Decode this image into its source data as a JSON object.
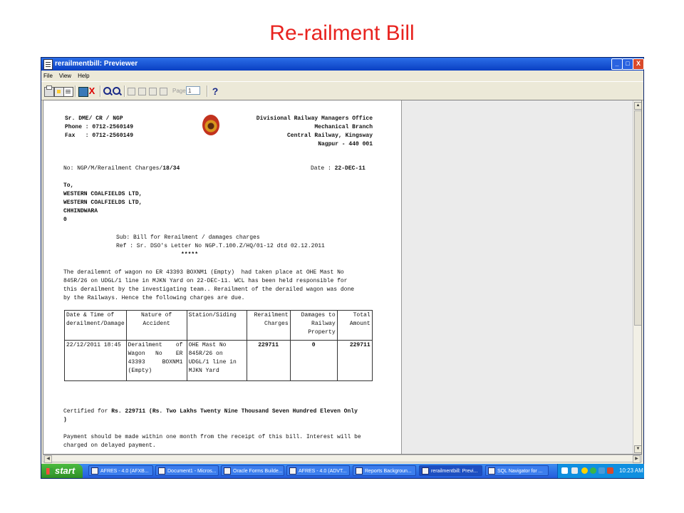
{
  "slide": {
    "title": "Re-railment Bill"
  },
  "window": {
    "title": "rerailmentbill: Previewer",
    "btn_min": "_",
    "btn_max": "□",
    "btn_close": "X"
  },
  "menu": {
    "file": "File",
    "view": "View",
    "help": "Help"
  },
  "toolbar": {
    "page_label": "Page",
    "page_value": "1",
    "close_glyph": "X",
    "help_glyph": "?"
  },
  "document": {
    "sender": {
      "line1": "Sr. DME/ CR / NGP",
      "phone": "Phone : 0712-2560149",
      "fax": "Fax   : 0712-2560149"
    },
    "office": {
      "line1": "Divisional Railway Managers Office",
      "line2": "Mechanical Branch",
      "line3": "Central Railway, Kingsway",
      "line4": "Nagpur - 440 001"
    },
    "ref_no_prefix": "No: NGP/M/Rerailment Charges/",
    "ref_no_bold": "18/34",
    "date_label": "Date : ",
    "date_value": "22-DEC-11",
    "to": {
      "label": "To,",
      "line1": "WESTERN COALFIELDS LTD,",
      "line2": "WESTERN COALFIELDS LTD,",
      "line3": "CHHINDWARA",
      "line4": "0"
    },
    "subject": "Sub: Bill for Rerailment / damages charges",
    "reference": "Ref : Sr. DSO's Letter No NGP.T.100.Z/HQ/01-12 dtd 02.12.2011",
    "stars": "*****",
    "para1": "The derailemnt of wagon no ER 43393 BOXNM1 (Empty)  had taken place at OHE Mast No",
    "para2": "845R/26 on UDGL/1 line in MJKN Yard on 22-DEC-11. WCL has been held responsible for",
    "para3": "this derailment by the investigating team.. Rerailment of the derailed wagon was done",
    "para4": "by the Railways. Hence the following charges are due.",
    "table": {
      "headers": {
        "date1": "Date & Time of",
        "date2": "derailment/Damage",
        "nature1": "Nature of",
        "nature2": "Accident",
        "station": "Station/Siding",
        "rerail1": "Rerailment",
        "rerail2": "Charges",
        "damage1": "Damages to",
        "damage2": "Railway",
        "damage3": "Property",
        "total1": "Total",
        "total2": "Amount"
      },
      "row": {
        "datetime": "22/12/2011 18:45",
        "nature1": "Derailment    of",
        "nature2": "Wagon   No    ER",
        "nature3": "43393     BOXNM1",
        "nature4": "(Empty)",
        "station1": "OHE Mast No",
        "station2": "845R/26 on",
        "station3": "UDGL/1 line in",
        "station4": "MJKN Yard",
        "rerailment": "229711",
        "damages": "0",
        "total": "229711"
      }
    },
    "certified_prefix": "Certified for ",
    "certified_bold": "Rs. 229711 (Rs. Two Lakhs Twenty Nine Thousand Seven Hundred Eleven Only",
    "certified_close": ")",
    "payment1": "Payment should be made within one month from the receipt of this bill. Interest will be",
    "payment2": "charged on delayed payment."
  },
  "taskbar": {
    "start": "start",
    "items": [
      "AFRES - 4.0 (AFXB...",
      "Document1 - Micros...",
      "Oracle Forms Builde...",
      "AFRES - 4.0 (ADVT...",
      "Reports Backgroun...",
      "rerailmentbill: Previ...",
      "SQL Navigator for ..."
    ],
    "clock": "10:23 AM"
  }
}
